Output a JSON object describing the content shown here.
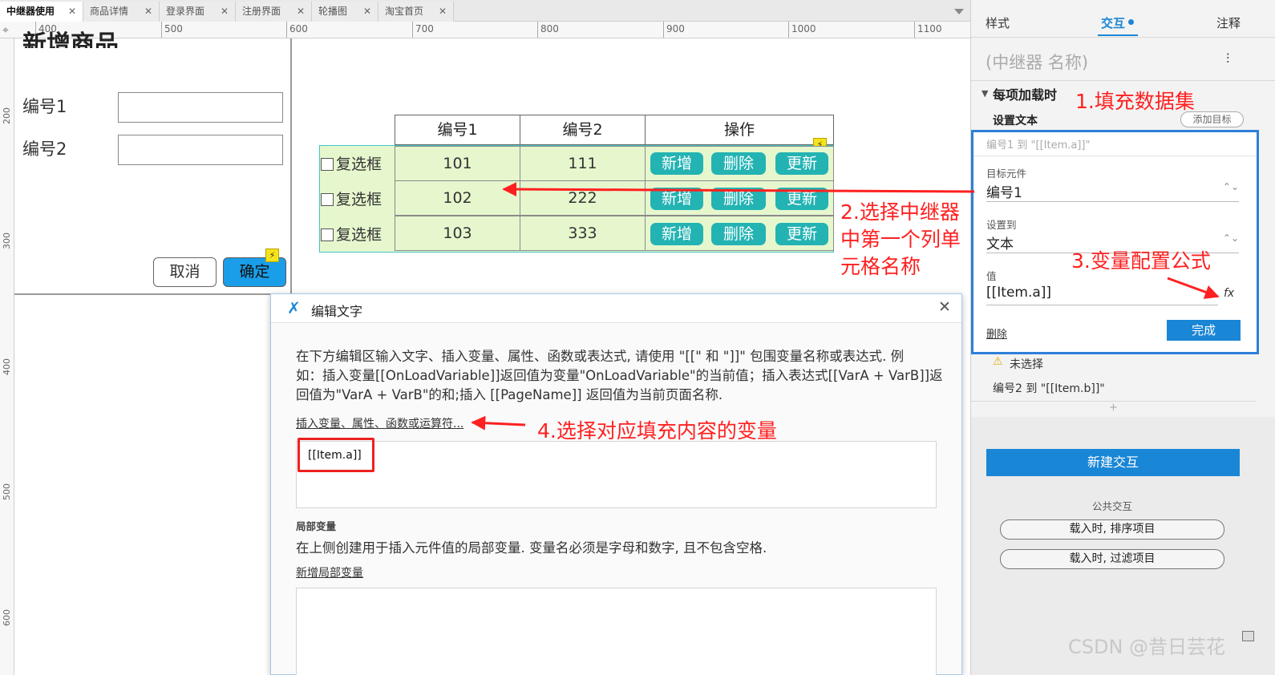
{
  "tabs": [
    {
      "label": "中继器使用",
      "active": true
    },
    {
      "label": "商品详情"
    },
    {
      "label": "登录界面"
    },
    {
      "label": "注册界面"
    },
    {
      "label": "轮播图"
    },
    {
      "label": "淘宝首页"
    }
  ],
  "ruler": {
    "h_labels": [
      "400",
      "500",
      "600",
      "700",
      "800",
      "900",
      "1000",
      "1100"
    ],
    "v_labels": [
      "200",
      "300",
      "400",
      "500",
      "600"
    ]
  },
  "form": {
    "title": "新增商品",
    "field1_label": "编号1",
    "field2_label": "编号2",
    "cancel": "取消",
    "confirm": "确定"
  },
  "table": {
    "headers": [
      "编号1",
      "编号2",
      "操作"
    ],
    "checkbox_label": "复选框",
    "rows": [
      {
        "a": "101",
        "b": "111"
      },
      {
        "a": "102",
        "b": "222"
      },
      {
        "a": "103",
        "b": "333"
      }
    ],
    "actions": [
      "新增",
      "删除",
      "更新"
    ]
  },
  "annotations": {
    "a1": "1.填充数据集",
    "a2_line1": "2.选择中继器",
    "a2_line2": "中第一个列单",
    "a2_line3": "元格名称",
    "a3": "3.变量配置公式",
    "a4": "4.选择对应填充内容的变量",
    "color": "#ff2020"
  },
  "dialog": {
    "title": "编辑文字",
    "desc_line1": "在下方编辑区输入文字、插入变量、属性、函数或表达式, 请使用 \"[[\" 和 \"]]\" 包围变量名称或表达式. 例",
    "desc_line2": "如：插入变量[[OnLoadVariable]]返回值为变量\"OnLoadVariable\"的当前值；插入表达式[[VarA + VarB]]返",
    "desc_line3": "回值为\"VarA + VarB\"的和;插入 [[PageName]] 返回值为当前页面名称.",
    "insert_link": "插入变量、属性、函数或运算符...",
    "editor_value": "[[Item.a]]",
    "local_vars_heading": "局部变量",
    "local_vars_desc": "在上侧创建用于插入元件值的局部变量. 变量名必须是字母和数字, 且不包含空格.",
    "add_local_var": "新增局部变量"
  },
  "right_panel": {
    "tabs": [
      "样式",
      "交互",
      "注释"
    ],
    "active_tab": "交互",
    "name_placeholder": "(中继器 名称)",
    "event": "每项加载时",
    "action": "设置文本",
    "add_target": "添加目标",
    "summary1": "编号1 到 \"[[Item.a]]\"",
    "target_label": "目标元件",
    "target_value": "编号1",
    "set_to_label": "设置到",
    "set_to_value": "文本",
    "value_label": "值",
    "value_value": "[[Item.a]]",
    "fx": "fx",
    "delete": "删除",
    "done": "完成",
    "unselected": "未选择",
    "summary2": "编号2 到 \"[[Item.b]]\"",
    "plus": "+",
    "new_interaction": "新建交互",
    "public_heading": "公共交互",
    "public_items": [
      "载入时, 排序项目",
      "载入时, 过滤项目"
    ],
    "accent": "#1a86d6"
  },
  "watermark": "CSDN @昔日芸花"
}
